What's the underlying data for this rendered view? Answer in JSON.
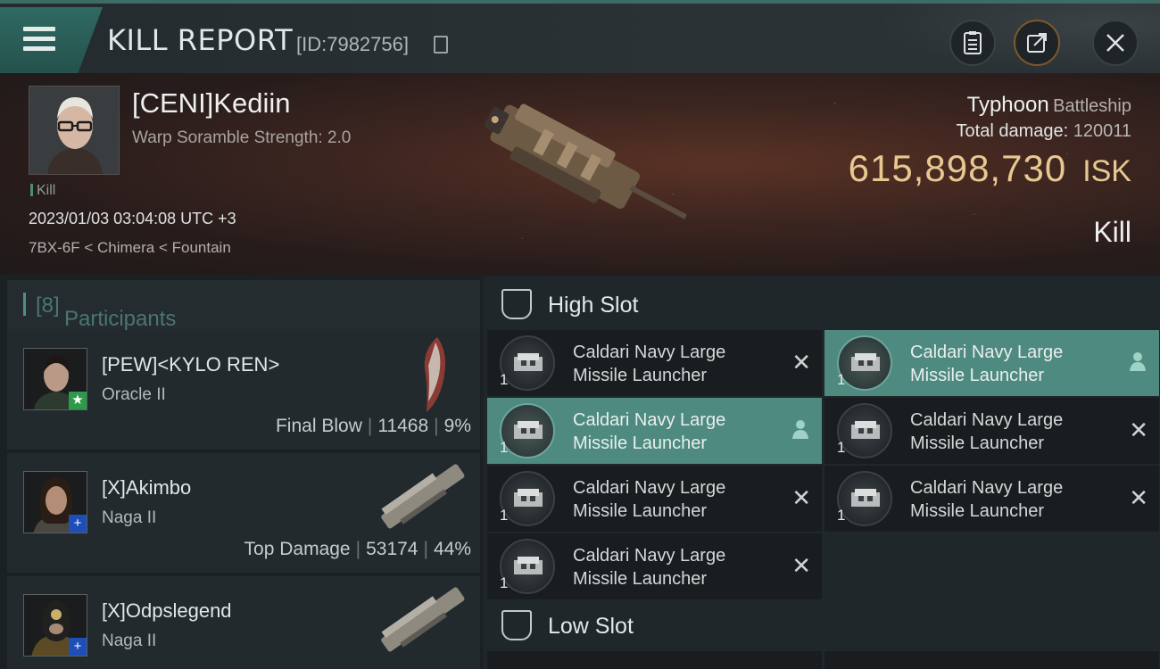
{
  "header": {
    "title": "KILL REPORT",
    "id_text": "[ID:7982756]",
    "menu_icon": "hamburger-menu-icon",
    "buttons": [
      "clipboard-icon",
      "share-icon",
      "close-icon"
    ]
  },
  "victim": {
    "name": "[CENI]Kediin",
    "subtitle": "Warp Soramble Strength: 2.0",
    "tag": "Kill",
    "datetime": "2023/01/03 03:04:08 UTC +3",
    "location": "7BX-6F < Chimera < Fountain",
    "ship_name": "Typhoon",
    "ship_class": "Battleship",
    "damage_label": "Total damage:",
    "damage_value": "120011",
    "isk_value": "615,898,730",
    "isk_unit": "ISK",
    "result": "Kill"
  },
  "participants": {
    "title": "Participants",
    "count": "[8]",
    "list": [
      {
        "name": "[PEW]<KYLO REN>",
        "ship": "Oracle II",
        "label": "Final Blow",
        "damage": "11468",
        "percent": "9%",
        "badge": "★",
        "badge_color": "#2c9a48"
      },
      {
        "name": "[X]Akimbo",
        "ship": "Naga II",
        "label": "Top Damage",
        "damage": "53174",
        "percent": "44%",
        "badge": "+",
        "badge_color": "#1e4fb8"
      },
      {
        "name": "[X]Odpslegend",
        "ship": "Naga II",
        "label": "",
        "damage": "",
        "percent": "",
        "badge": "+",
        "badge_color": "#1e4fb8"
      }
    ]
  },
  "high_slot": {
    "title": "High Slot",
    "items": [
      {
        "name_line1": "Caldari Navy Large",
        "name_line2": "Missile Launcher",
        "qty": "1",
        "status": "destroyed"
      },
      {
        "name_line1": "Caldari Navy Large",
        "name_line2": "Missile Launcher",
        "qty": "1",
        "status": "dropped"
      },
      {
        "name_line1": "Caldari Navy Large",
        "name_line2": "Missile Launcher",
        "qty": "1",
        "status": "dropped"
      },
      {
        "name_line1": "Caldari Navy Large",
        "name_line2": "Missile Launcher",
        "qty": "1",
        "status": "destroyed"
      },
      {
        "name_line1": "Caldari Navy Large",
        "name_line2": "Missile Launcher",
        "qty": "1",
        "status": "destroyed"
      },
      {
        "name_line1": "Caldari Navy Large",
        "name_line2": "Missile Launcher",
        "qty": "1",
        "status": "destroyed"
      },
      {
        "name_line1": "Caldari Navy Large",
        "name_line2": "Missile Launcher",
        "qty": "1",
        "status": "destroyed"
      }
    ]
  },
  "low_slot": {
    "title": "Low Slot"
  },
  "colors": {
    "accent": "#4e8a80",
    "isk": "#e8c891"
  }
}
